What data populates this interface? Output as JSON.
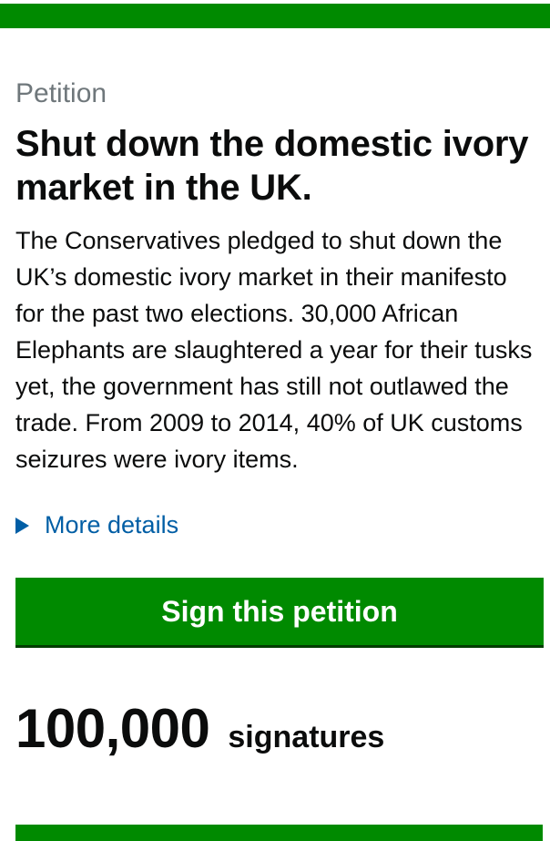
{
  "colors": {
    "brand_green": "#008a00",
    "link_blue": "#005ea5",
    "kicker_grey": "#6f777b",
    "text": "#0b0c0c"
  },
  "header": {
    "kicker": "Petition",
    "title": "Shut down the domestic ivory market in the UK."
  },
  "summary": "The Conservatives pledged to shut down the UK’s domestic ivory market in their manifesto for the past two elections. 30,000 African Elephants are slaughtered a year for their tusks yet, the government has still not outlawed the trade. From 2009 to 2014, 40% of UK customs seizures were ivory items.",
  "details": {
    "icon": "triangle-right-icon",
    "label": "More details"
  },
  "actions": {
    "sign_label": "Sign this petition"
  },
  "signatures": {
    "count": "100,000",
    "unit": "signatures"
  }
}
